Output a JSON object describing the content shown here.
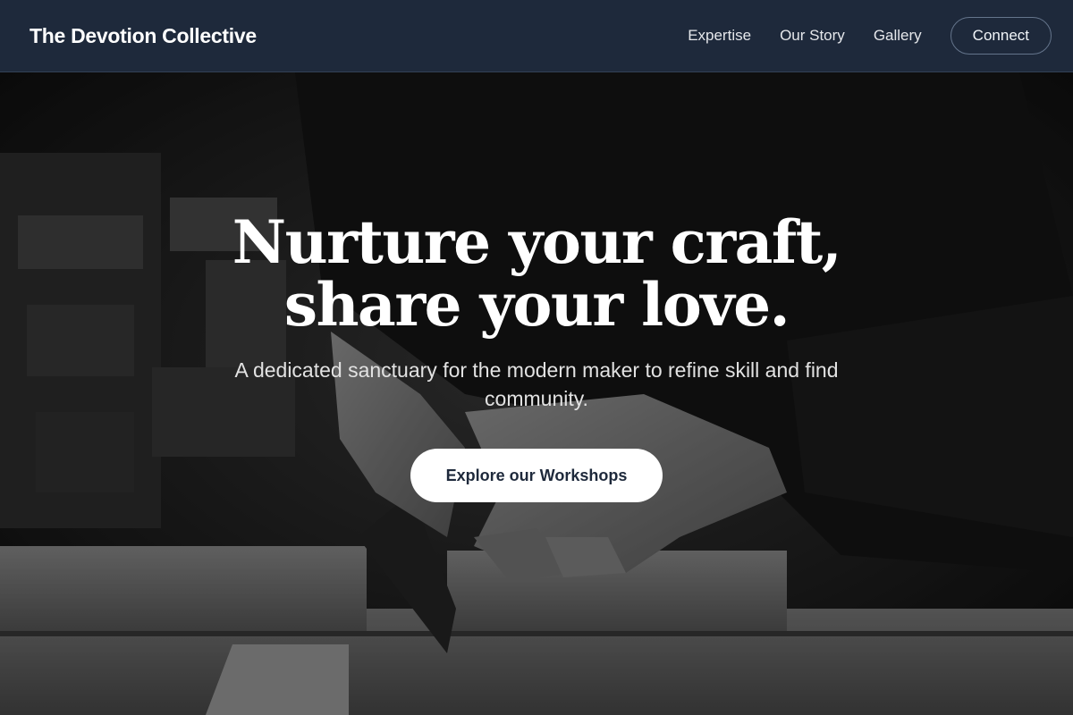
{
  "nav": {
    "brand": "The Devotion Collective",
    "links": [
      "Expertise",
      "Our Story",
      "Gallery"
    ],
    "connect_label": "Connect"
  },
  "hero": {
    "title_line1": "Nurture your craft,",
    "title_line2": "share your love.",
    "subtitle": "A dedicated sanctuary for the modern maker to refine skill and find community.",
    "cta_label": "Explore our Workshops",
    "image_subject": "woodworker-hands-sawing-photo"
  },
  "colors": {
    "nav_bg": "#1e293b",
    "cta_bg": "#ffffff",
    "cta_text": "#1e293b"
  }
}
